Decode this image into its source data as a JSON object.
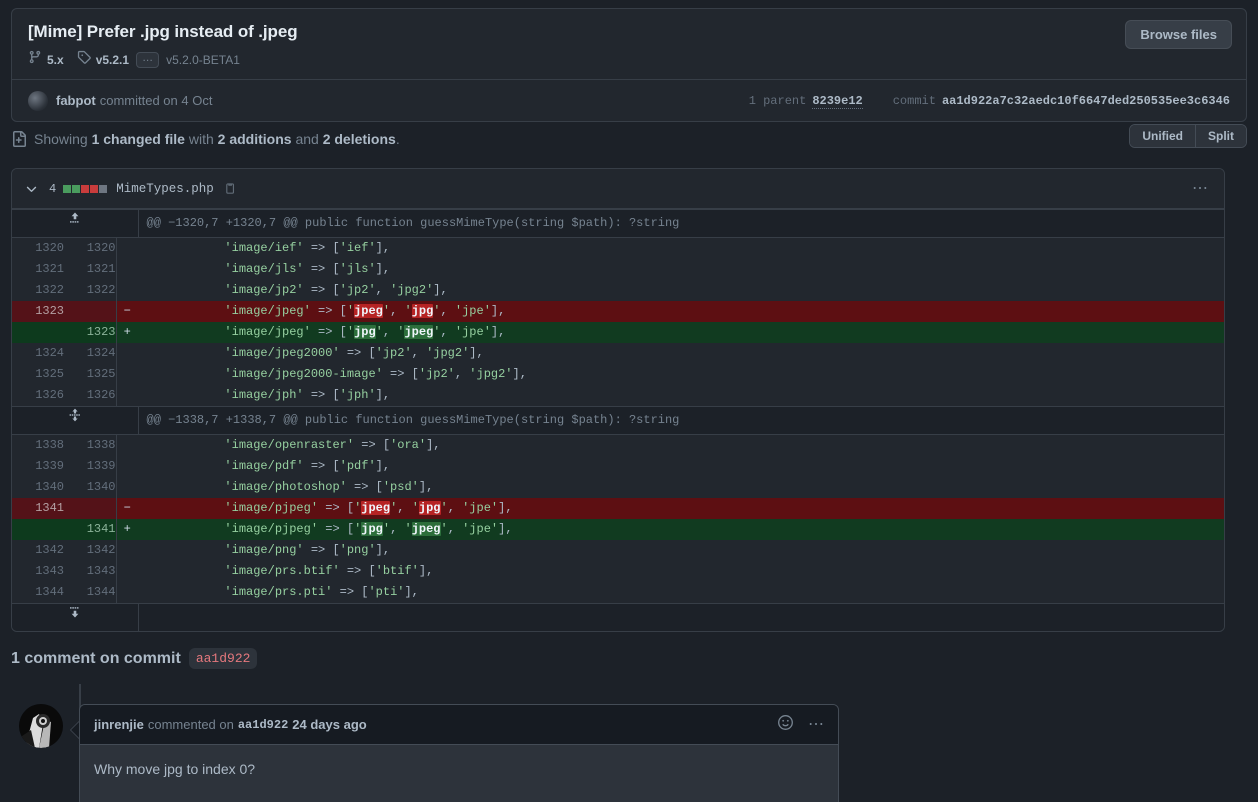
{
  "commit": {
    "title": "[Mime] Prefer .jpg instead of .jpeg",
    "branch": "5.x",
    "tag": "v5.2.1",
    "ellipsis": "…",
    "tag2": "v5.2.0-BETA1",
    "browse_files_label": "Browse files",
    "author": "fabpot",
    "committed_text": "committed on 4 Oct",
    "parent_label": "1 parent",
    "parent_sha": "8239e12",
    "commit_label": "commit",
    "commit_sha": "aa1d922a7c32aedc10f6647ded250535ee3c6346"
  },
  "summary": {
    "prefix": "Showing",
    "files": "1 changed file",
    "with": "with",
    "additions": "2 additions",
    "and": "and",
    "deletions": "2 deletions",
    "period": ".",
    "unified_label": "Unified",
    "split_label": "Split"
  },
  "file": {
    "change_count": "4",
    "name": "MimeTypes.php",
    "stat_squares": [
      "#4a9c5e",
      "#4a9c5e",
      "#c93c3c",
      "#c93c3c",
      "#6e7681"
    ]
  },
  "hunks": [
    {
      "header": "@@ −1320,7 +1320,7 @@ public function guessMimeType(string $path): ?string",
      "expander": "up",
      "rows": [
        {
          "type": "ctx",
          "old": "1320",
          "new": "1320",
          "marker": "",
          "code": "            'image/ief' => ['ief'],"
        },
        {
          "type": "ctx",
          "old": "1321",
          "new": "1321",
          "marker": "",
          "code": "            'image/jls' => ['jls'],"
        },
        {
          "type": "ctx",
          "old": "1322",
          "new": "1322",
          "marker": "",
          "code": "            'image/jp2' => ['jp2', 'jpg2'],"
        },
        {
          "type": "del",
          "old": "1323",
          "new": "",
          "marker": "−",
          "code": "            'image/jpeg' => ['jpeg', 'jpg', 'jpe'],"
        },
        {
          "type": "add",
          "old": "",
          "new": "1323",
          "marker": "+",
          "code": "            'image/jpeg' => ['jpg', 'jpeg', 'jpe'],"
        },
        {
          "type": "ctx",
          "old": "1324",
          "new": "1324",
          "marker": "",
          "code": "            'image/jpeg2000' => ['jp2', 'jpg2'],"
        },
        {
          "type": "ctx",
          "old": "1325",
          "new": "1325",
          "marker": "",
          "code": "            'image/jpeg2000-image' => ['jp2', 'jpg2'],"
        },
        {
          "type": "ctx",
          "old": "1326",
          "new": "1326",
          "marker": "",
          "code": "            'image/jph' => ['jph'],"
        }
      ]
    },
    {
      "header": "@@ −1338,7 +1338,7 @@ public function guessMimeType(string $path): ?string",
      "expander": "updown",
      "rows": [
        {
          "type": "ctx",
          "old": "1338",
          "new": "1338",
          "marker": "",
          "code": "            'image/openraster' => ['ora'],"
        },
        {
          "type": "ctx",
          "old": "1339",
          "new": "1339",
          "marker": "",
          "code": "            'image/pdf' => ['pdf'],"
        },
        {
          "type": "ctx",
          "old": "1340",
          "new": "1340",
          "marker": "",
          "code": "            'image/photoshop' => ['psd'],"
        },
        {
          "type": "del",
          "old": "1341",
          "new": "",
          "marker": "−",
          "code": "            'image/pjpeg' => ['jpeg', 'jpg', 'jpe'],"
        },
        {
          "type": "add",
          "old": "",
          "new": "1341",
          "marker": "+",
          "code": "            'image/pjpeg' => ['jpg', 'jpeg', 'jpe'],"
        },
        {
          "type": "ctx",
          "old": "1342",
          "new": "1342",
          "marker": "",
          "code": "            'image/png' => ['png'],"
        },
        {
          "type": "ctx",
          "old": "1343",
          "new": "1343",
          "marker": "",
          "code": "            'image/prs.btif' => ['btif'],"
        },
        {
          "type": "ctx",
          "old": "1344",
          "new": "1344",
          "marker": "",
          "code": "            'image/prs.pti' => ['pti'],"
        }
      ]
    }
  ],
  "comments": {
    "heading": "1 comment on commit",
    "heading_sha": "aa1d922",
    "items": [
      {
        "author": "jinrenjie",
        "action": "commented on",
        "sha": "aa1d922",
        "when": "24 days ago",
        "body": "Why move jpg to index 0?"
      }
    ]
  }
}
